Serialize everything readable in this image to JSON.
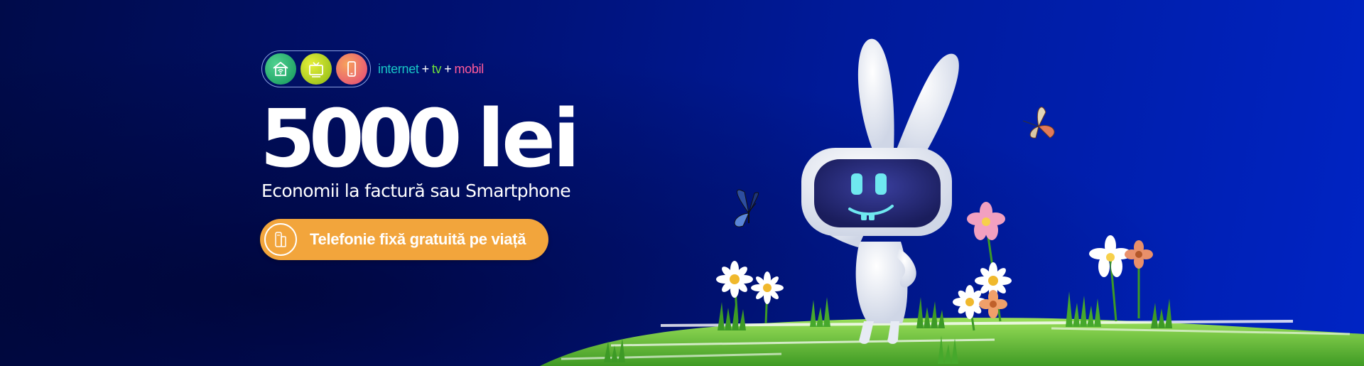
{
  "services": {
    "items": [
      {
        "name": "internet",
        "icon": "house-wifi-icon",
        "color": "#18c6c6"
      },
      {
        "name": "tv",
        "icon": "tv-icon",
        "color": "#6ee03a"
      },
      {
        "name": "mobil",
        "icon": "smartphone-icon",
        "color": "#ff5b9a"
      }
    ],
    "plus": "+"
  },
  "offer": {
    "amount": "5000",
    "currency": "lei",
    "subtitle": "Economii la factură sau Smartphone"
  },
  "cta": {
    "label": "Telefonie fixă gratuită pe viață",
    "icon": "landline-phone-icon",
    "color": "#f2a53c"
  },
  "colors": {
    "background_dark": "#000b4a",
    "background_light": "#0024c4",
    "grass": "#6fc03a"
  }
}
